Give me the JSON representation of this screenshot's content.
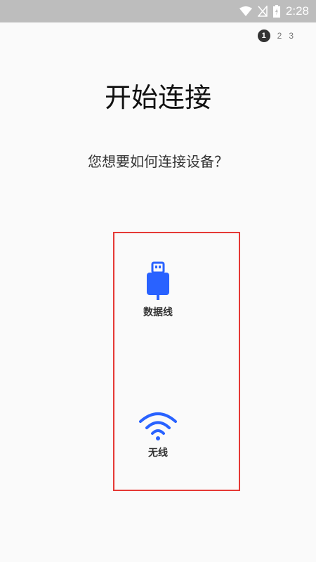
{
  "status_bar": {
    "time": "2:28",
    "icons": [
      "wifi-icon",
      "no-signal-icon",
      "battery-charging-icon"
    ]
  },
  "steps": [
    "1",
    "2",
    "3"
  ],
  "current_step": "1",
  "title": "开始连接",
  "subtitle": "您想要如何连接设备？",
  "options": {
    "usb": {
      "label": "数据线",
      "icon": "usb-cable-icon"
    },
    "wifi": {
      "label": "无线",
      "icon": "wifi-icon"
    }
  },
  "colors": {
    "accent": "#2962ff",
    "highlight_border": "#e53935",
    "status_bar": "#bdbdbd",
    "background": "#fafafa"
  }
}
